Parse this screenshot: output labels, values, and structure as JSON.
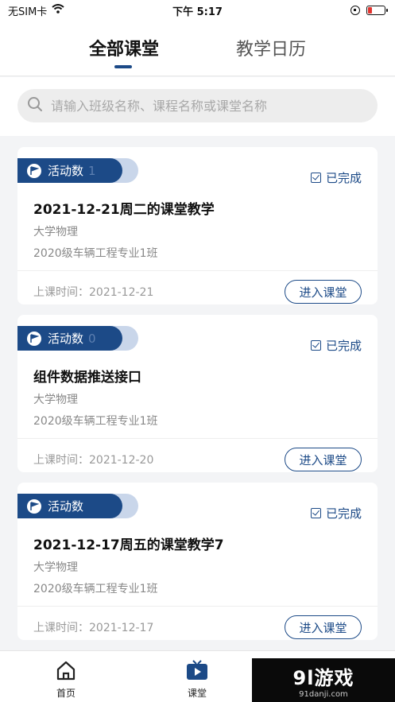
{
  "status_bar": {
    "carrier": "无SIM卡",
    "time": "下午 5:17"
  },
  "tabs": {
    "all": "全部课堂",
    "calendar": "教学日历"
  },
  "search": {
    "placeholder": "请输入班级名称、课程名称或课堂名称"
  },
  "cards": [
    {
      "badge_label": "活动数",
      "badge_count": "1",
      "status": "已完成",
      "title": "2021-12-21周二的课堂教学",
      "subject": "大学物理",
      "class_name": "2020级车辆工程专业1班",
      "time": "上课时间：2021-12-21",
      "button": "进入课堂"
    },
    {
      "badge_label": "活动数",
      "badge_count": "0",
      "status": "已完成",
      "title": "组件数据推送接口",
      "subject": "大学物理",
      "class_name": "2020级车辆工程专业1班",
      "time": "上课时间：2021-12-20",
      "button": "进入课堂"
    },
    {
      "badge_label": "活动数",
      "badge_count": "",
      "status": "已完成",
      "title": "2021-12-17周五的课堂教学7",
      "subject": "大学物理",
      "class_name": "2020级车辆工程专业1班",
      "time": "上课时间：2021-12-17",
      "button": "进入课堂"
    }
  ],
  "bottom_nav": {
    "home": "首页",
    "classroom": "课堂"
  },
  "watermark": {
    "main": "9l游戏",
    "sub": "91danji.com"
  },
  "colors": {
    "primary": "#1c4a87",
    "battery_low": "#e3342f"
  }
}
